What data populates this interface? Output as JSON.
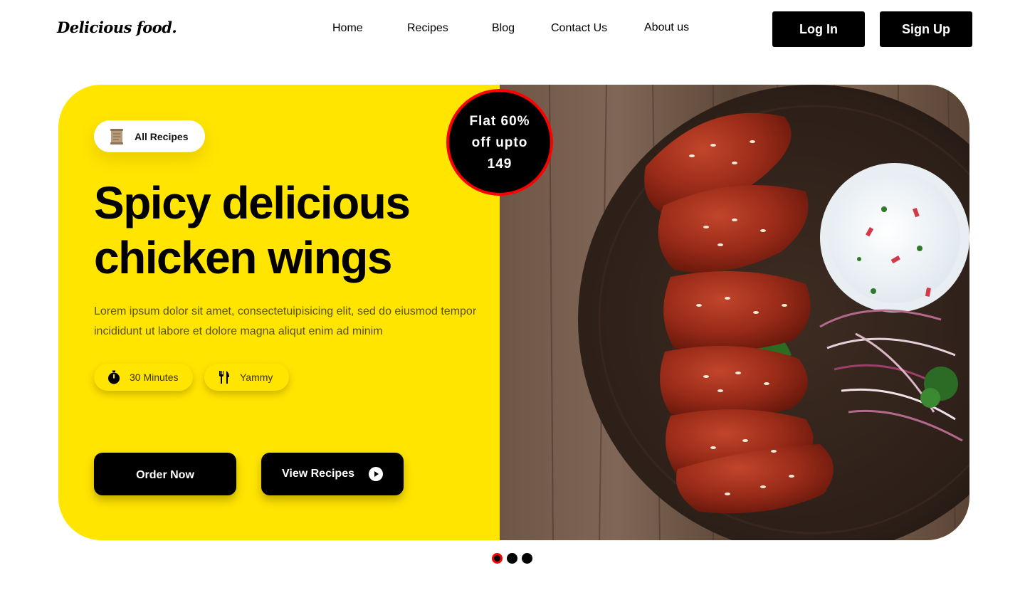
{
  "header": {
    "logo": "Delicious food.",
    "nav": [
      "Home",
      "Recipes",
      "Blog",
      "Contact Us",
      "About us"
    ],
    "login_label": "Log In",
    "signup_label": "Sign Up"
  },
  "hero": {
    "chip_label": "All Recipes",
    "title_line1": "Spicy delicious",
    "title_line2": "chicken wings",
    "description": "Lorem ipsum dolor sit amet, consectetuipisicing elit, sed do eiusmod tempor incididunt ut labore et dolore magna aliqut enim ad minim",
    "tags": [
      {
        "label": "30 Minutes",
        "icon": "timer-icon"
      },
      {
        "label": "Yammy",
        "icon": "fork-knife-icon"
      }
    ],
    "order_label": "Order Now",
    "view_label": "View Recipes",
    "offer_text": "Flat 60% off upto 149"
  },
  "carousel": {
    "count": 3,
    "active_index": 0
  },
  "colors": {
    "accent_yellow": "#FFE500",
    "offer_border": "#FF0000",
    "button_bg": "#000000",
    "active_dot": "#FF0000"
  }
}
